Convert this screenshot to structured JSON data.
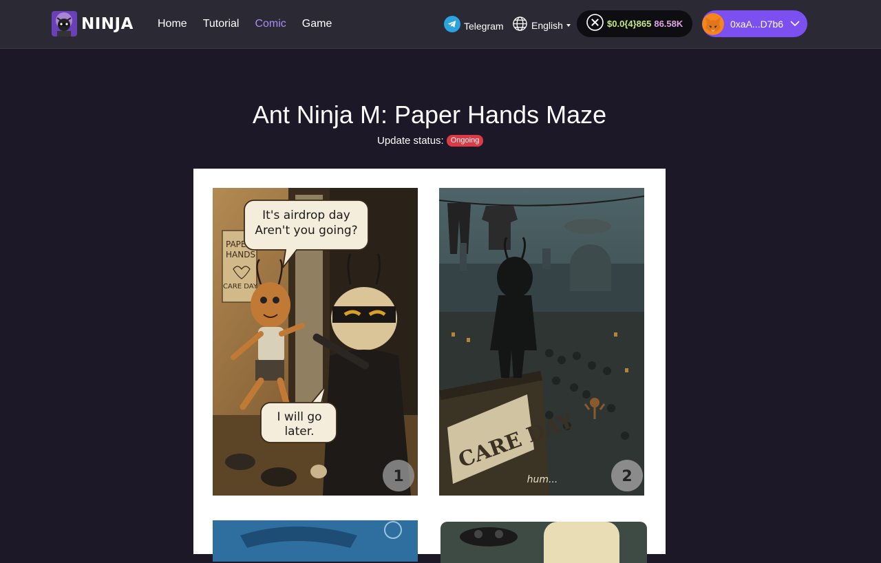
{
  "brand": {
    "name": "NINJA"
  },
  "nav": {
    "items": [
      {
        "label": "Home",
        "active": false
      },
      {
        "label": "Tutorial",
        "active": false
      },
      {
        "label": "Comic",
        "active": true
      },
      {
        "label": "Game",
        "active": false
      }
    ]
  },
  "header": {
    "telegram_label": "Telegram",
    "language_label": "English",
    "price": "$0.0{4}865",
    "volume": "86.58K",
    "wallet_address": "0xaA...D7b6"
  },
  "comic": {
    "title": "Ant Ninja M: Paper Hands Maze",
    "status_label": "Update status:",
    "status_badge": "Ongoing",
    "panels": [
      {
        "number": "1",
        "bubble_top_line1": "It's airdrop day",
        "bubble_top_line2": "Aren't you going?",
        "bubble_bottom_line1": "I will go",
        "bubble_bottom_line2": "later.",
        "sign_line1": "PAPER",
        "sign_line2": "HANDS",
        "sign_line3": "CARE DAY"
      },
      {
        "number": "2",
        "banner": "CARE DAY",
        "caption": "hum..."
      }
    ]
  },
  "colors": {
    "accent": "#7b4ff0",
    "active_nav": "#a88ef5",
    "badge": "#dc3b45",
    "background": "#1c1828",
    "header": "#2b2933"
  }
}
